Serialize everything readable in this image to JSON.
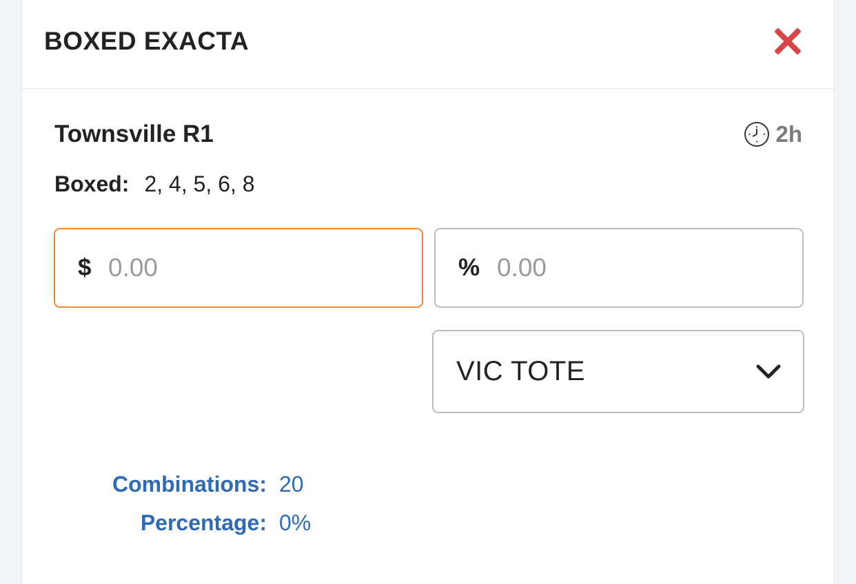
{
  "header": {
    "title": "BOXED EXACTA",
    "close_icon": "close-icon"
  },
  "race": {
    "name": "Townsville R1",
    "time_to_start": "2h",
    "timer_icon": "clock-icon"
  },
  "boxed": {
    "label": "Boxed:",
    "runners": "2, 4, 5, 6, 8"
  },
  "amount_field": {
    "prefix": "$",
    "placeholder": "0.00",
    "value": ""
  },
  "percent_field": {
    "prefix": "%",
    "placeholder": "0.00",
    "value": ""
  },
  "tote_select": {
    "selected": "VIC TOTE",
    "icon": "chevron-down-icon"
  },
  "stats": {
    "combinations_label": "Combinations:",
    "combinations_value": "20",
    "percentage_label": "Percentage:",
    "percentage_value": "0%"
  },
  "colors": {
    "accent_focus": "#ee8a33",
    "close_red": "#d64547",
    "stats_blue": "#2f6bb5",
    "border_gray": "#b9bcc3"
  }
}
